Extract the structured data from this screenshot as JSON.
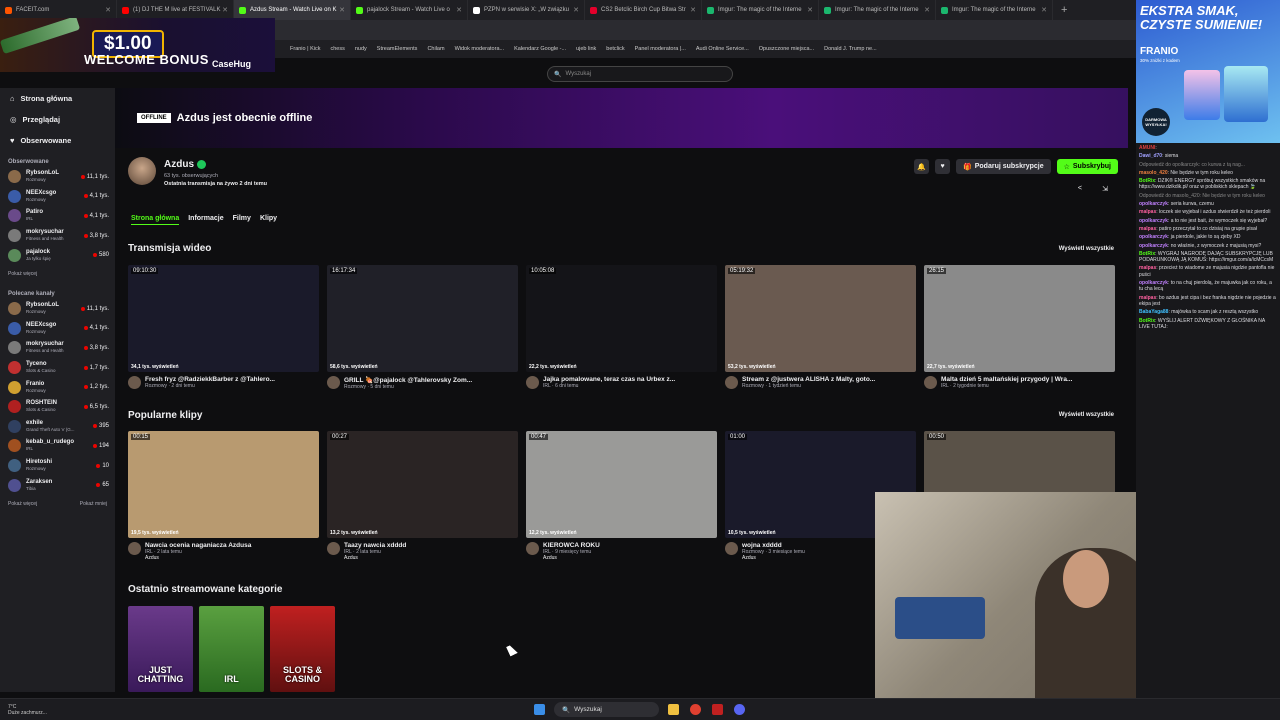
{
  "browser_tabs": [
    {
      "label": "FACEIT.com",
      "color": "#ff5500",
      "active": false
    },
    {
      "label": "(1) DJ THE M live at FESTIVALK",
      "color": "#ff0000",
      "active": false
    },
    {
      "label": "Azdus Stream - Watch Live on K",
      "color": "#53fc18",
      "active": true
    },
    {
      "label": "pajalock Stream - Watch Live o",
      "color": "#53fc18",
      "active": false
    },
    {
      "label": "PZPN w serwisie X: „W związku",
      "color": "#ffffff",
      "active": false
    },
    {
      "label": "CS2 Betclic Birch Cup Bitwa Str",
      "color": "#e4002b",
      "active": false
    },
    {
      "label": "Imgur: The magic of the Interne",
      "color": "#1bb76e",
      "active": false
    },
    {
      "label": "Imgur: The magic of the Interne",
      "color": "#1bb76e",
      "active": false
    },
    {
      "label": "Imgur: The magic of the Interne",
      "color": "#1bb76e",
      "active": false
    }
  ],
  "bookmarks": [
    "Franio | Kick",
    "chess",
    "nudy",
    "StreamElements",
    "Chilam",
    "Widok moderatora...",
    "Kalendarz Google -...",
    "ujeb link",
    "betclick",
    "Panel moderatora |...",
    "Audi Online Service...",
    "Opuszczone miejsca...",
    "Donald J. Trump ne..."
  ],
  "promo": {
    "amount": "$1.00",
    "bonus": "WELCOME BONUS",
    "brand": "CaseHug"
  },
  "search": {
    "placeholder": "Wyszukaj"
  },
  "sidebar": {
    "nav": [
      {
        "label": "Strona główna",
        "icon": "home-icon"
      },
      {
        "label": "Przeglądaj",
        "icon": "compass-icon"
      },
      {
        "label": "Obserwowane",
        "icon": "heart-icon"
      }
    ],
    "followed_header": "Obserwowane",
    "followed": [
      {
        "name": "RybsonLoL",
        "cat": "Rozmowy",
        "viewers": "11,1 tys.",
        "color": "#8a6a4a"
      },
      {
        "name": "NEEXcsgo",
        "cat": "Rozmowy",
        "viewers": "4,1 tys.",
        "color": "#3a5ca8"
      },
      {
        "name": "Patiro",
        "cat": "IRL",
        "viewers": "4,1 tys.",
        "color": "#6a4a8a"
      },
      {
        "name": "mokrysuchar",
        "cat": "Fitness and Health",
        "viewers": "3,8 tys.",
        "color": "#7a7a7a"
      },
      {
        "name": "pajalock",
        "cat": "Ja tylko śpię",
        "viewers": "580",
        "color": "#5a8a5a"
      }
    ],
    "more_followed": "Pokaż więcej",
    "recommended_header": "Polecane kanały",
    "recommended": [
      {
        "name": "RybsonLoL",
        "cat": "Rozmowy",
        "viewers": "11,1 tys.",
        "color": "#8a6a4a"
      },
      {
        "name": "NEEXcsgo",
        "cat": "Rozmowy",
        "viewers": "4,1 tys.",
        "color": "#3a5ca8"
      },
      {
        "name": "mokrysuchar",
        "cat": "Fitness and Health",
        "viewers": "3,8 tys.",
        "color": "#7a7a7a"
      },
      {
        "name": "Tyceno",
        "cat": "Slots & Casino",
        "viewers": "1,7 tys.",
        "color": "#c03030"
      },
      {
        "name": "Franio",
        "cat": "Rozmowy",
        "viewers": "1,2 tys.",
        "color": "#d0a030"
      },
      {
        "name": "ROSHTEIN",
        "cat": "Slots & Casino",
        "viewers": "6,5 tys.",
        "color": "#b02020"
      },
      {
        "name": "exhile",
        "cat": "Grand Theft Auto V (G...",
        "viewers": "395",
        "color": "#304060"
      },
      {
        "name": "kebab_u_rudego",
        "cat": "IRL",
        "viewers": "194",
        "color": "#a05020"
      },
      {
        "name": "Hiretoshi",
        "cat": "Rozmowy",
        "viewers": "10",
        "color": "#406080"
      },
      {
        "name": "Zaraksen",
        "cat": "Tibia",
        "viewers": "65",
        "color": "#505090"
      }
    ],
    "more": "Pokaż więcej",
    "less": "Pokaż mniej"
  },
  "banner": {
    "offline": "OFFLINE",
    "title": "Azdus jest obecnie offline"
  },
  "profile": {
    "name": "Azdus",
    "followers": "63 tys. obserwujących",
    "last": "Ostatnia transmisja na żywo 2 dni temu",
    "gift_label": "Podaruj subskrypcje",
    "sub_label": "Subskrybuj"
  },
  "tabs": [
    "Strona główna",
    "Informacje",
    "Filmy",
    "Klipy"
  ],
  "videos_section": {
    "title": "Transmisja wideo",
    "all": "Wyświetl wszystkie"
  },
  "videos": [
    {
      "duration": "09:10:30",
      "views": "34,1 tys. wyświetleń",
      "title": "Fresh fryz @RadziekkBarber z @Tahlero...",
      "cat": "Rozmowy",
      "date": "2 dni temu",
      "bg": "#1a1a2a"
    },
    {
      "duration": "16:17:34",
      "views": "58,6 tys. wyświetleń",
      "title": "GRILL 🍖@pajalock @Tahlerovsky Zom...",
      "cat": "Rozmowy",
      "date": "5 dni temu",
      "bg": "#202028"
    },
    {
      "duration": "10:05:08",
      "views": "22,2 tys. wyświetleń",
      "title": "Jajka pomalowane, teraz czas na Urbex z...",
      "cat": "IRL",
      "date": "6 dni temu",
      "bg": "#141418"
    },
    {
      "duration": "05:19:32",
      "views": "53,2 tys. wyświetleń",
      "title": "Stream z @justwera ALISHA z Malty, goto...",
      "cat": "Rozmowy",
      "date": "1 tydzień temu",
      "bg": "#6a5a50"
    },
    {
      "duration": "26:15",
      "views": "22,7 tys. wyświetleń",
      "title": "Malta dzień 5 maltańskiej przygody | Wra...",
      "cat": "IRL",
      "date": "2 tygodnie temu",
      "bg": "#8a8a8a"
    }
  ],
  "clips_section": {
    "title": "Popularne klipy",
    "all": "Wyświetl wszystkie"
  },
  "clips": [
    {
      "duration": "00:15",
      "views": "19,5 tys. wyświetleń",
      "title": "Nawcia ocenia naganiacza Azdusa",
      "cat": "IRL",
      "date": "2 lata temu",
      "author": "Azdus",
      "bg": "#b89a70"
    },
    {
      "duration": "00:27",
      "views": "13,2 tys. wyświetleń",
      "title": "Taazy nawcia xdddd",
      "cat": "IRL",
      "date": "2 lata temu",
      "author": "Azdus",
      "bg": "#2a2424"
    },
    {
      "duration": "00:47",
      "views": "12,2 tys. wyświetleń",
      "title": "KIEROWCA ROKU",
      "cat": "IRL",
      "date": "9 miesięcy temu",
      "author": "Azdus",
      "bg": "#9a9a98"
    },
    {
      "duration": "01:00",
      "views": "10,5 tys. wyświetleń",
      "title": "wojna xdddd",
      "cat": "Rozmowy",
      "date": "3 miesiące temu",
      "author": "Azdus",
      "bg": "#1a1a2a"
    },
    {
      "duration": "00:50",
      "views": "",
      "title": "",
      "cat": "",
      "date": "",
      "author": "",
      "bg": "#5a5248"
    }
  ],
  "categories_section": {
    "title": "Ostatnio streamowane kategorie"
  },
  "categories": [
    {
      "label": "JUST CHATTING",
      "bg": "linear-gradient(#6a3a8a,#3a1a5a)"
    },
    {
      "label": "IRL",
      "bg": "linear-gradient(#5aa040,#2a6a20)"
    },
    {
      "label": "SLOTS & CASINO",
      "bg": "linear-gradient(#c02020,#601010)"
    }
  ],
  "ad": {
    "headline": "EKSTRA SMAK, CZYSTE SUMIENIE!",
    "brand": "FRANIO",
    "small": "30% zniżki z kodem",
    "badge": "DARMOWA WYSYŁKA!"
  },
  "chat": [
    {
      "user": "AMUNI",
      "color": "#e04040",
      "text": ""
    },
    {
      "user": "Dawi_d70",
      "color": "#a0a0ff",
      "text": "siema"
    },
    {
      "user": "",
      "color": "#888",
      "text": "Odpowiedź do opolkarczyk: co kurwa z tą nag..."
    },
    {
      "user": "masolo_420",
      "color": "#f08040",
      "text": "Nie będzie w tym roku keleo"
    },
    {
      "user": "BotRix",
      "color": "#53fc18",
      "text": "DZIK® ENERGY spróbuj wszystkich smaków na https://www.dzikdik.pl/ oraz w pobliskich sklepach 🍃"
    },
    {
      "user": "",
      "color": "#888",
      "text": "Odpowiedź do masolo_420: Nie będzie w tym roku keleo"
    },
    {
      "user": "opolkarczyk",
      "color": "#c080ff",
      "text": "seria kurwa, czemu"
    },
    {
      "user": "malpas",
      "color": "#ff60a0",
      "text": "loczek sie wyjebał i azdus stwierdził że też pierdoli"
    },
    {
      "user": "opolkarczyk",
      "color": "#c080ff",
      "text": "a to nie jest bait, że wymoczek się wyjebał?"
    },
    {
      "user": "malpas",
      "color": "#ff60a0",
      "text": "patiro przeczytał to co dzisiaj na grupie pisał"
    },
    {
      "user": "opolkarczyk",
      "color": "#c080ff",
      "text": "ja pierdole, jakie to są zjeby XD"
    },
    {
      "user": "opolkarczyk",
      "color": "#c080ff",
      "text": "no właśnie, z wymoczek z majusią mysi?"
    },
    {
      "user": "BotRix",
      "color": "#53fc18",
      "text": "WYGRAJ NAGRODĘ DAJĄC SUBSKRYPCJĘ LUB PODARUNKOWĄ JĄ KOMUŚ: https://imgur.com/a/lcMCcsM"
    },
    {
      "user": "malpas",
      "color": "#ff60a0",
      "text": "przecież to wiadome ze majusia nigdzie pantofla nie puści"
    },
    {
      "user": "opolkarczyk",
      "color": "#c080ff",
      "text": "to na chuj pierdolą, że majuwka jak co roku, a tu cha lecą"
    },
    {
      "user": "malpas",
      "color": "#ff60a0",
      "text": "bo azdus jest cipa i bez franka nigdzie nie pojedzie a ekipa jest"
    },
    {
      "user": "BabaYaga88",
      "color": "#40c0ff",
      "text": "majówka to scam jak z resztą wszystko"
    },
    {
      "user": "BotRix",
      "color": "#53fc18",
      "text": "WYŚLIJ ALERT DŹWIĘKOWY Z GŁOŚNIKA NA LIVE TUTAJ:"
    }
  ],
  "taskbar": {
    "weather_temp": "7°C",
    "weather_desc": "Duże zachmurz...",
    "search": "Wyszukaj"
  }
}
